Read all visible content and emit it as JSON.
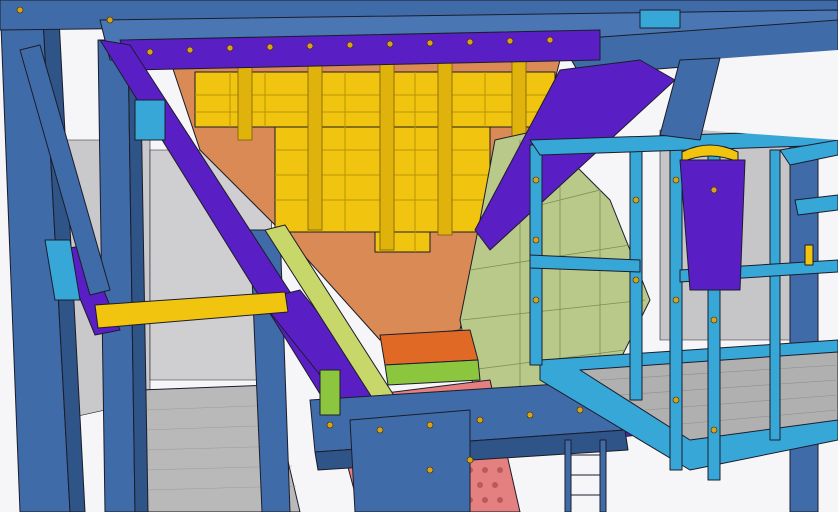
{
  "scene": {
    "description_label": "",
    "palette": {
      "structural_steel": "#3f6ca8",
      "steel_dark": "#2f5487",
      "bracing_purple": "#5a1fc4",
      "liner_yellow": "#f1c40f",
      "hopper_orange": "#d98a55",
      "wear_plate_green": "#b9c98a",
      "platform_cyan": "#37a7d8",
      "grating_gray": "#b8b8b8",
      "chute_red": "#e58080",
      "wall_gray": "#c9c9cc"
    }
  }
}
